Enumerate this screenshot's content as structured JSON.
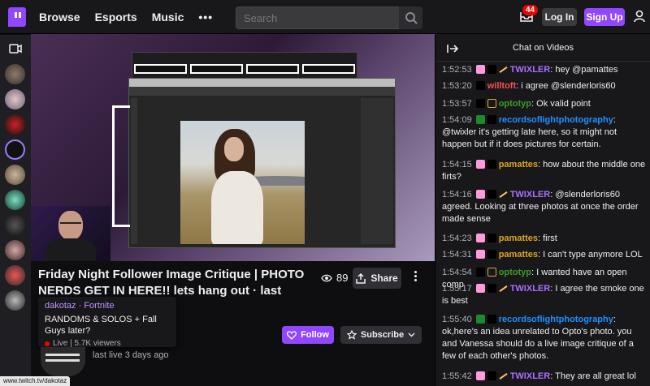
{
  "topbar": {
    "nav": [
      "Browse",
      "Esports",
      "Music"
    ],
    "more": "•••",
    "search_placeholder": "Search",
    "notification_count": "44",
    "login": "Log In",
    "signup": "Sign Up"
  },
  "video": {
    "title": "Friday Night Follower Image Critique | PHOTO NERDS GET IN HERE!! lets hang out  ·  last month",
    "views": "89",
    "share": "Share",
    "follow": "Follow",
    "subscribe": "Subscribe",
    "last_live": "last live 3 days ago"
  },
  "popup": {
    "channel": "dakotaz",
    "separator": " · ",
    "game": "Fortnite",
    "title": "RANDOMS & SOLOS + Fall Guys later?",
    "live": "Live | 5.7K viewers"
  },
  "status_url": "www.twitch.tv/dakotaz",
  "chat": {
    "title": "Chat on Videos",
    "messages": [
      {
        "time": "1:52:53",
        "badges": [
          "heart",
          "drop",
          "wand"
        ],
        "user": "TWIXLER",
        "color": "purple",
        "text": "hey @pamattes"
      },
      {
        "time": "1:53:20",
        "badges": [
          "drop"
        ],
        "user": "willtoft",
        "color": "red",
        "text": "i agree @slenderloris60"
      },
      {
        "time": "1:53:57",
        "badges": [
          "drop",
          "sub"
        ],
        "user": "optotyp",
        "color": "green",
        "text": "Ok valid point"
      },
      {
        "time": "1:54:09",
        "badges": [
          "green",
          "drop"
        ],
        "user": "recordsoflightphotography",
        "color": "blue",
        "text": "@twixler it's getting late here, so it might not happen but if it does pictures for certain."
      },
      {
        "time": "1:54:15",
        "badges": [
          "heart",
          "drop"
        ],
        "user": "pamattes",
        "color": "yellow",
        "text": "how about the middle one firts?"
      },
      {
        "time": "1:54:16",
        "badges": [
          "heart",
          "drop",
          "wand"
        ],
        "user": "TWIXLER",
        "color": "purple",
        "text": "@slenderloris60 agreed. Looking at three photos at once the order made sense"
      },
      {
        "time": "1:54:23",
        "badges": [
          "heart",
          "drop"
        ],
        "user": "pamattes",
        "color": "yellow",
        "text": "first"
      },
      {
        "time": "1:54:31",
        "badges": [
          "heart",
          "drop"
        ],
        "user": "pamattes",
        "color": "yellow",
        "text": "I can't type anymore LOL"
      },
      {
        "time": "1:54:54",
        "badges": [
          "drop",
          "sub"
        ],
        "user": "optotyp",
        "color": "green",
        "text": "I wanted have an open comp"
      },
      {
        "time": "1:55:17",
        "badges": [
          "heart",
          "drop",
          "wand"
        ],
        "user": "TWIXLER",
        "color": "purple",
        "text": "I agree the smoke one is best"
      },
      {
        "time": "1:55:40",
        "badges": [
          "green",
          "drop"
        ],
        "user": "recordsoflightphotography",
        "color": "blue",
        "text": "ok,here's an idea unrelated to Opto's photo. you and Vanessa should do a live image critique of a few of each other's photos."
      },
      {
        "time": "1:55:42",
        "badges": [
          "heart",
          "drop",
          "wand"
        ],
        "user": "TWIXLER",
        "color": "purple",
        "text": "They are all great lol"
      }
    ]
  }
}
